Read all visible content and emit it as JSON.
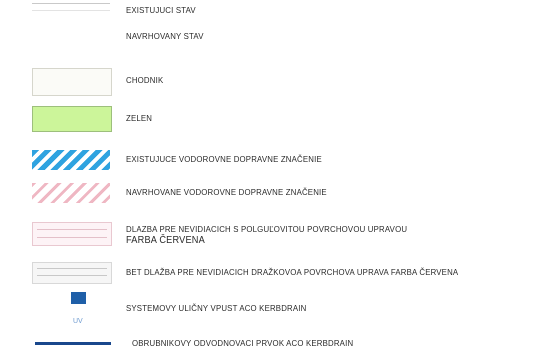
{
  "legend": {
    "items": [
      {
        "label": "EXISTUJUCI STAV"
      },
      {
        "label": "NAVRHOVANY STAV"
      },
      {
        "label": "CHODNIK"
      },
      {
        "label": "ZELEN"
      },
      {
        "label": "EXISTUJUCE VODOROVNE DOPRAVNE ZNAČENIE"
      },
      {
        "label": "NAVRHOVANE VODOROVNE DOPRAVNE ZNAČENIE"
      },
      {
        "label": "DLAZBA PRE NEVIDIACICH S POLGUĽOVITOU POVRCHOVOU UPRAVOU",
        "label2": "FARBA  ČERVENA"
      },
      {
        "label": "BET  DLAŽBA PRE NEVIDIACICH DRAŽKOVOA POVRCHOVA UPRAVA  FARBA  ČERVENA"
      },
      {
        "label": "SYSTEMOVY ULIČNY VPUST  ACO KERBDRAIN",
        "tag": "UV"
      },
      {
        "label": "OBRUBNIKOVY ODVODNOVACI PRVOK ACO KERBDRAIN"
      }
    ]
  },
  "colors": {
    "green_fill": "#ccf59a",
    "blue_hatch": "#2fa3e0",
    "pink_hatch": "#efb7c3",
    "inlet_blue": "#1f5fa8",
    "drain_blue": "#19478c"
  }
}
